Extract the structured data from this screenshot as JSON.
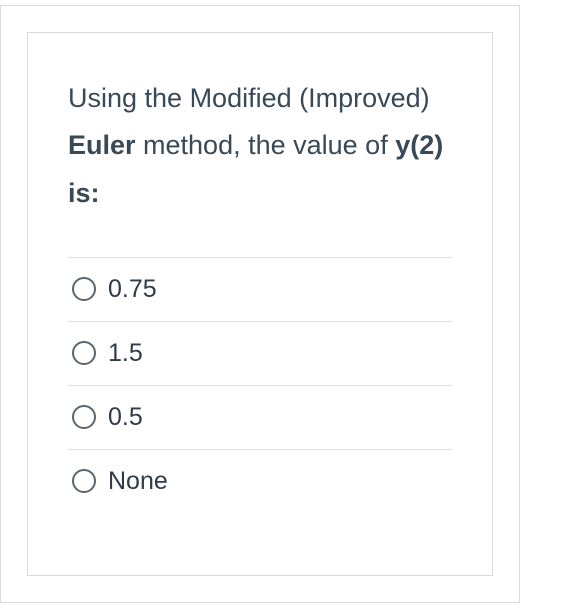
{
  "question": {
    "part1": "Using the Modified (Improved) ",
    "bold1": "Euler",
    "part2": " method, the value of ",
    "bold2": "y(2) is:"
  },
  "options": [
    {
      "label": "0.75"
    },
    {
      "label": "1.5"
    },
    {
      "label": "0.5"
    },
    {
      "label": "None"
    }
  ]
}
